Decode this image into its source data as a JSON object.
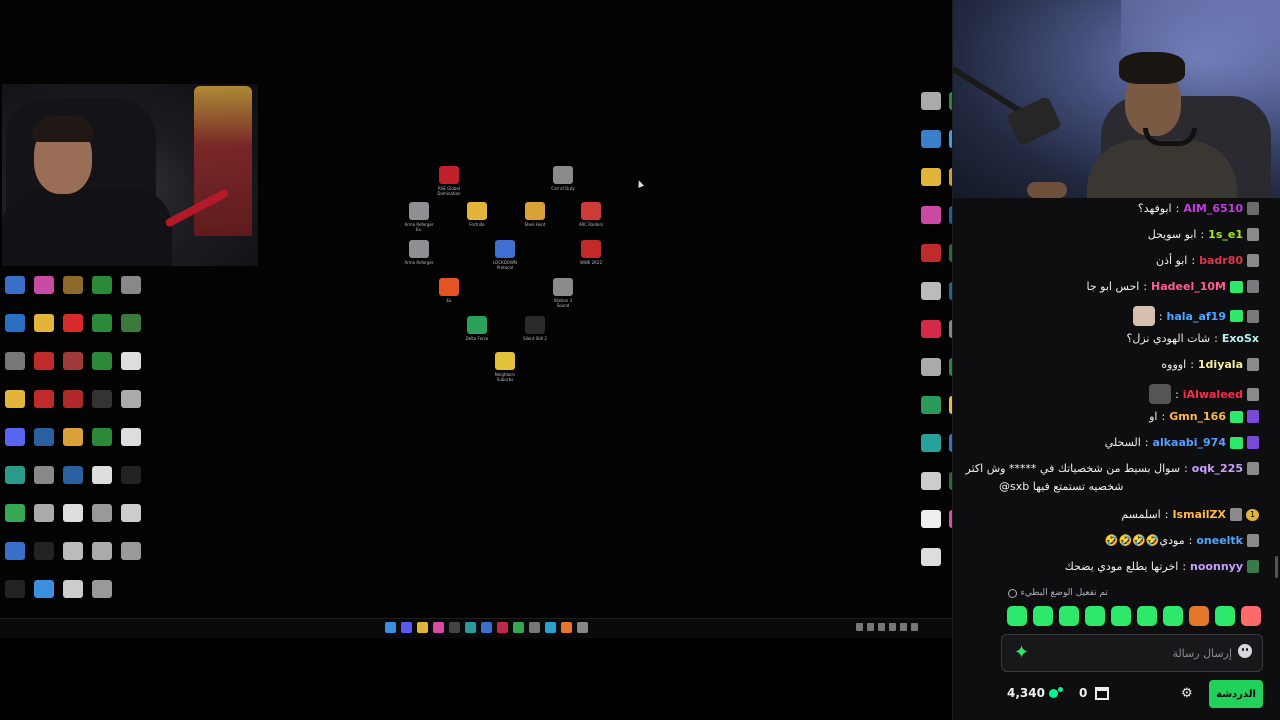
{
  "center_icons": [
    {
      "label": "RSE Global Domination",
      "color": "#c0202a"
    },
    {
      "label": "Call of Duty",
      "color": "#8a8a8a"
    },
    {
      "label": "Arma Reforger Ex.",
      "color": "#8d8f92"
    },
    {
      "label": "Fortnite",
      "color": "#e2b53a"
    },
    {
      "label": "Steel Hunt",
      "color": "#d8a238"
    },
    {
      "label": "ARC Raiders",
      "color": "#cc3a3a"
    },
    {
      "label": "Arma Reforger",
      "color": "#8d8f92"
    },
    {
      "label": "LOCKDOWN Protocol",
      "color": "#3f6fd1"
    },
    {
      "label": "WWE 2K22",
      "color": "#c22a2a"
    },
    {
      "label": "Ea",
      "color": "#e25522"
    },
    {
      "label": "Station 3 Sound",
      "color": "#8a8a8a"
    },
    {
      "label": "Delta Force",
      "color": "#2ba05a"
    },
    {
      "label": "Silent Still 2",
      "color": "#2a2a2a"
    },
    {
      "label": "Neighbors Suburbs",
      "color": "#e2c23a"
    }
  ],
  "left_icons_colors": [
    "#3a6fc7",
    "#c84aa4",
    "#8b6a2a",
    "#2a8a3a",
    "#888",
    "#2a6fc0",
    "#e2b53a",
    "#d82a2a",
    "#2a8a3a",
    "#3a7a3a",
    "#777",
    "#c02a2a",
    "#a03a3a",
    "#2a8a3a",
    "#ddd",
    "#e2b53a",
    "#c02a2a",
    "#b02a2a",
    "#333",
    "#aaa",
    "#5865f2",
    "#2a5fa0",
    "#d8a238",
    "#2a8a3a",
    "#ddd",
    "#2a9a8a",
    "#888",
    "#2a5fa0",
    "#ddd",
    "#222",
    "#34a853",
    "#aaa",
    "#ddd",
    "#999",
    "#ccc",
    "#3a6fc7",
    "#222",
    "#bbb",
    "#aaa",
    "#999",
    "#222",
    "#3a8fdf",
    "#ccc",
    "#999"
  ],
  "right_icons_colors": [
    "#aaa",
    "#2a8a3a",
    "#3a7fc7",
    "#3a9fef",
    "#e2b53a",
    "#c8a03a",
    "#c84aa4",
    "#2a5a9a",
    "#c02a2a",
    "#2a6a3a",
    "#bbb",
    "#1a6a8a",
    "#d22a4a",
    "#888",
    "#aaa",
    "#2a8a3a",
    "#2a9a5a",
    "#e2c23a",
    "#2aa09a",
    "#3a6fc7",
    "#ccc",
    "#2a6a3a",
    "#eee",
    "#d8509a",
    "#ddd"
  ],
  "taskbar_icons": [
    "#3a8fdf",
    "#5a5aef",
    "#e2b53a",
    "#d84aa4",
    "#444",
    "#2a9a9a",
    "#3a6fc7",
    "#c02a4a",
    "#34a853",
    "#777",
    "#2aa0d0",
    "#e2762a",
    "#888"
  ],
  "chat": {
    "messages": [
      {
        "user": "AIM_6510",
        "color": "#c13de0",
        "text": "ابوفهد؟",
        "badge_color": "#6b6b6b"
      },
      {
        "user": "1s_e1",
        "color": "#9ef01a",
        "text": "ابو سويحل",
        "badge_color": "#8a8a8a"
      },
      {
        "user": "badr80",
        "color": "#d9384a",
        "text": "ابو أذن",
        "badge_color": "#8a8a8a"
      },
      {
        "user": "Hadeel_10M",
        "color": "#ff5f8f",
        "text": "احس ابو جا",
        "badge_color": "#7a7a7a",
        "badge2_color": "#2ee86b"
      },
      {
        "user": "hala_af19",
        "color": "#4ea7ff",
        "text": "",
        "badge_color": "#7a7a7a",
        "badge2_color": "#2ee86b",
        "emote_color": "#d8c0b0"
      },
      {
        "user": "ExoSx",
        "color": "#b9f2f0",
        "text": "شات الهودي نزل؟",
        "badge_color": ""
      },
      {
        "user": "1diyala",
        "color": "#f3f0a0",
        "text": "اوووه",
        "badge_color": "#8a8a8a"
      },
      {
        "user": "iAlwaleed",
        "color": "#ff2a4a",
        "text": "",
        "badge_color": "#8a8a8a",
        "emote_color": "#555"
      },
      {
        "user": "Gmn_166",
        "color": "#ffb84a",
        "text": "او",
        "badge_color": "#7a4ad6",
        "badge2_color": "#2ee86b"
      },
      {
        "user": "alkaabi_974",
        "color": "#5b9cff",
        "text": "السحلي",
        "badge_color": "#7a4ad6",
        "badge2_color": "#2ee86b"
      },
      {
        "user": "oqk_225",
        "color": "#c9a0ff",
        "text": "سوال بسيط من شخصياتك في ***** وش اكثر",
        "text2": "@sxb شخصيه تستمتع فيها",
        "badge_color": "#8a8a8a"
      },
      {
        "user": "IsmailZX",
        "color": "#ffb84a",
        "text": "اسلمسم",
        "badge_color": "#8a8a8a",
        "num_badge": "1"
      },
      {
        "user": "oneeltk",
        "color": "#4ea7ff",
        "text": "مودي🤣🤣🤣🤣",
        "badge_color": "#8a8a8a"
      },
      {
        "user": "noonnyy",
        "color": "#c9a0ff",
        "text": "اخرتها يطلع مودي يضحك",
        "badge_color": "#3a7a4a"
      }
    ],
    "slow_mode": "تم تفعيل الوضع البطيء",
    "emotes": [
      "#2ee86b",
      "#2ee86b",
      "#2ee86b",
      "#2ee86b",
      "#2ee86b",
      "#2ee86b",
      "#2ee86b",
      "#e2762a",
      "#2ee86b",
      "#ff6a6a"
    ],
    "input_placeholder": "إرسال رسالة",
    "points": "4,340",
    "store_count": "0",
    "send_label": "الدردشة",
    "accent": "#22d15a"
  }
}
